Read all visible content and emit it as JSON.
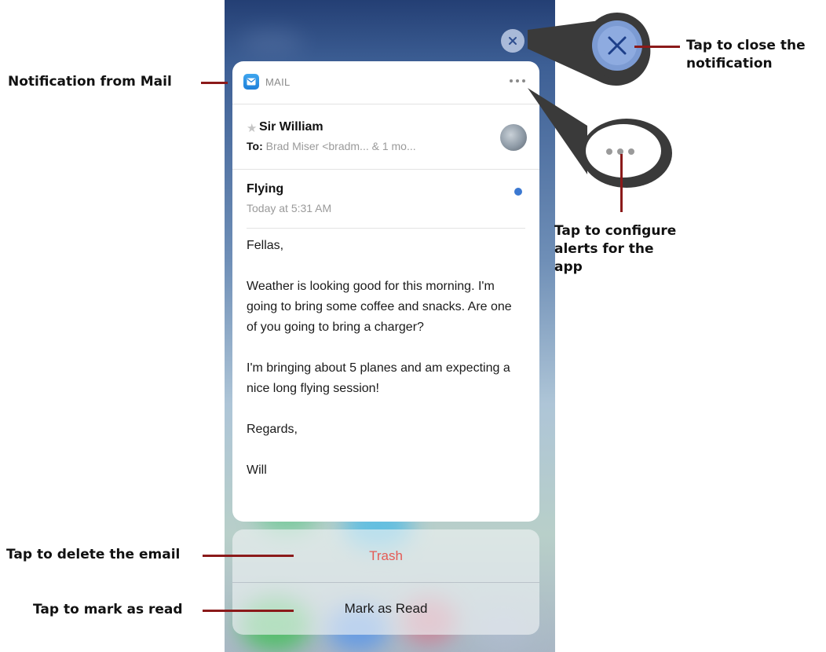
{
  "notification": {
    "app_name": "MAIL",
    "sender": "Sir William",
    "to_label": "To:",
    "to_value": "Brad Miser <bradm... & 1 mo...",
    "subject": "Flying",
    "date": "Today at 5:31 AM",
    "body": [
      "Fellas,",
      "Weather is looking good for this morning. I'm going to bring some coffee and snacks. Are one of you going to bring a charger?",
      "I'm bringing about 5 planes and am expecting a nice long flying session!",
      "Regards,",
      "Will"
    ]
  },
  "actions": {
    "trash_label": "Trash",
    "mark_read_label": "Mark as Read"
  },
  "callouts": {
    "notification_from": "Notification from Mail",
    "close": [
      "Tap to close the",
      "notification"
    ],
    "configure": [
      "Tap to configure",
      "alerts for the",
      "app"
    ],
    "delete": "Tap to delete the email",
    "mark_read": "Tap to mark as read"
  },
  "colors": {
    "leader": "#8b1a1a",
    "trash": "#e45a55",
    "unread_dot": "#3b78d1",
    "callout_bubble": "#3a3a3a"
  },
  "icons": {
    "mail_app": "mail-icon",
    "close": "close-icon",
    "more": "more-icon",
    "star": "star-icon"
  }
}
